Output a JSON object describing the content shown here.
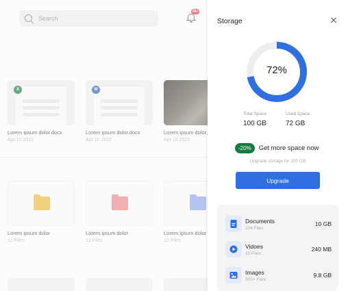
{
  "search": {
    "placeholder": "Search"
  },
  "notifications": {
    "badge": "99+"
  },
  "files": [
    {
      "title": "Lorem ipsum dolor.docx",
      "date": "Apr 10 2022",
      "app": "X",
      "app_color": "#1d7a43"
    },
    {
      "title": "Lorem ipsum dolor.docx",
      "date": "Apr 10 2022",
      "app": "W",
      "app_color": "#2b5cb5"
    },
    {
      "title": "Lorem ipsum dolor.docx",
      "date": "Apr 10 2022"
    }
  ],
  "folders": [
    {
      "title": "Lorem ipsum dolor",
      "count": "12 Files",
      "color": "#e7b83a"
    },
    {
      "title": "Lorem ipsum dolor",
      "count": "12 Files",
      "color": "#e8868a"
    },
    {
      "title": "Lorem ipsum dolor",
      "count": "12 Files",
      "color": "#8ea7e6"
    }
  ],
  "storage": {
    "title": "Storage",
    "used_percent": 72,
    "percent_label": "72%",
    "total_label": "Total Space",
    "total_value": "100 GB",
    "used_label": "Used Space",
    "used_value": "72 GB",
    "promo_badge": "-20%",
    "promo_text": "Get more space now",
    "promo_sub": "Upgrade storage for 200 GB",
    "upgrade_label": "Upgrade",
    "accent": "#2f6fe0",
    "items": [
      {
        "name": "Documents",
        "count": "234 Files",
        "size": "10 GB",
        "icon": "document-icon"
      },
      {
        "name": "Vidoes",
        "count": "10 Files",
        "size": "240 MB",
        "icon": "play-icon"
      },
      {
        "name": "Images",
        "count": "900+ Files",
        "size": "9.8 GB",
        "icon": "image-icon"
      }
    ]
  }
}
